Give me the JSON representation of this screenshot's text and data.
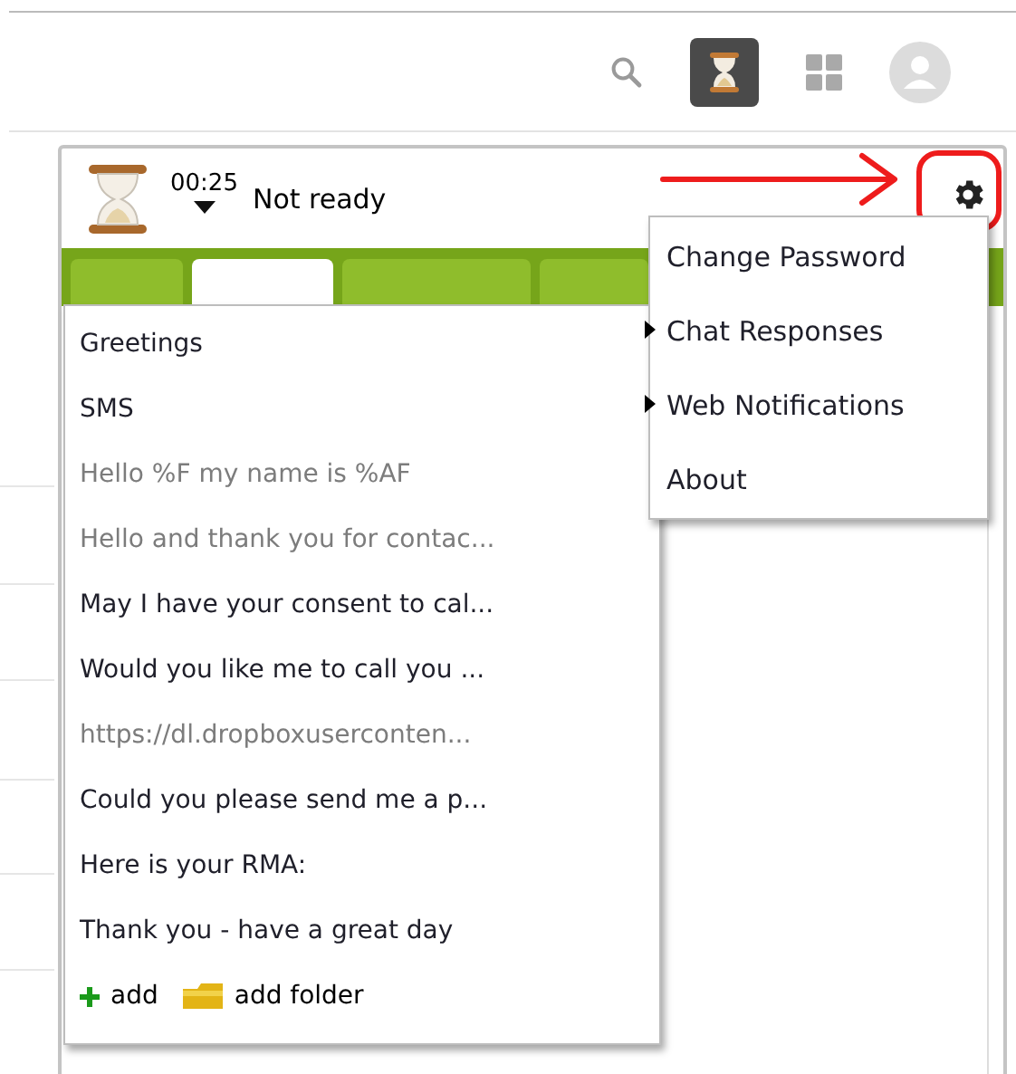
{
  "toolbar": [
    {
      "kind": "search",
      "selected": false
    },
    {
      "kind": "hourglass",
      "selected": true
    },
    {
      "kind": "apps",
      "selected": false
    },
    {
      "kind": "avatar",
      "selected": false
    }
  ],
  "status": {
    "timer": "00:25",
    "label": "Not ready"
  },
  "tabs": [
    {
      "selected": false
    },
    {
      "selected": true
    },
    {
      "selected": false
    },
    {
      "selected": false
    }
  ],
  "responses": [
    {
      "label": "Greetings",
      "dimmed": false
    },
    {
      "label": "SMS",
      "dimmed": false
    },
    {
      "label": "Hello %F my name is %AF",
      "dimmed": true
    },
    {
      "label": "Hello and thank you for contac...",
      "dimmed": true
    },
    {
      "label": "May I have your consent to cal...",
      "dimmed": false
    },
    {
      "label": "Would you like me to call you ...",
      "dimmed": false
    },
    {
      "label": "https://dl.dropboxuserconten...",
      "dimmed": true
    },
    {
      "label": "Could you please send me a p...",
      "dimmed": false
    },
    {
      "label": "Here is your RMA:",
      "dimmed": false
    },
    {
      "label": "Thank you - have a great day",
      "dimmed": false
    }
  ],
  "actions": [
    {
      "kind": "add",
      "label": "add"
    },
    {
      "kind": "folder",
      "label": "add folder"
    }
  ],
  "settings_menu": [
    {
      "label": "Change Password",
      "submenu": false
    },
    {
      "label": "Chat Responses",
      "submenu": true
    },
    {
      "label": "Web Notifications",
      "submenu": true
    },
    {
      "label": "About",
      "submenu": false
    }
  ]
}
